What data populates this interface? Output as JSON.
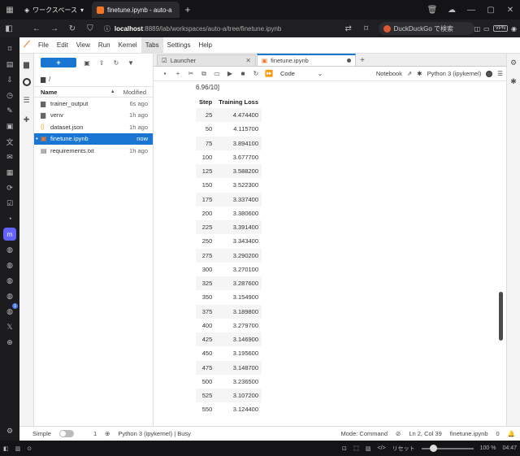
{
  "browser": {
    "workspace_label": "ワークスペース",
    "tab_title": "finetune.ipynb - auto-a",
    "url_host": "localhost",
    "url_rest": ":8889/lab/workspaces/auto-a/tree/finetune.ipynb",
    "search_placeholder": "DuckDuckGo で検索",
    "vpn_label": "VPN",
    "reset_label": "リセット",
    "zoom_level": "100 %",
    "clock": "04:47"
  },
  "menu": [
    "File",
    "Edit",
    "View",
    "Run",
    "Kernel",
    "Tabs",
    "Settings",
    "Help"
  ],
  "filebrowser": {
    "path": "/",
    "col_name": "Name",
    "col_modified": "Modified",
    "files": [
      {
        "name": "trainer_output",
        "modified": "6s ago",
        "type": "folder"
      },
      {
        "name": "venv",
        "modified": "1h ago",
        "type": "folder"
      },
      {
        "name": "dataset.json",
        "modified": "1h ago",
        "type": "json"
      },
      {
        "name": "finetune.ipynb",
        "modified": "now",
        "type": "notebook",
        "selected": true
      },
      {
        "name": "requirements.txt",
        "modified": "1h ago",
        "type": "file"
      }
    ]
  },
  "tabs": [
    {
      "label": "Launcher"
    },
    {
      "label": "finetune.ipynb"
    }
  ],
  "notebook": {
    "cell_type": "Code",
    "notebook_label": "Notebook",
    "kernel_name": "Python 3 (ipykernel)",
    "progress_text": "6.96/10]",
    "table": {
      "headers": [
        "Step",
        "Training Loss"
      ],
      "rows": [
        [
          "25",
          "4.474400"
        ],
        [
          "50",
          "4.115700"
        ],
        [
          "75",
          "3.894100"
        ],
        [
          "100",
          "3.677700"
        ],
        [
          "125",
          "3.588200"
        ],
        [
          "150",
          "3.522300"
        ],
        [
          "175",
          "3.337400"
        ],
        [
          "200",
          "3.380600"
        ],
        [
          "225",
          "3.391400"
        ],
        [
          "250",
          "3.343400"
        ],
        [
          "275",
          "3.290200"
        ],
        [
          "300",
          "3.270100"
        ],
        [
          "325",
          "3.287600"
        ],
        [
          "350",
          "3.154900"
        ],
        [
          "375",
          "3.189800"
        ],
        [
          "400",
          "3.279700"
        ],
        [
          "425",
          "3.146900"
        ],
        [
          "450",
          "3.195600"
        ],
        [
          "475",
          "3.148700"
        ],
        [
          "500",
          "3.236500"
        ],
        [
          "525",
          "3.107200"
        ],
        [
          "550",
          "3.124400"
        ]
      ]
    }
  },
  "status": {
    "simple_label": "Simple",
    "terminals_count": "1",
    "kernel_status": "Python 3 (ipykernel) | Busy",
    "mode": "Mode: Command",
    "cursor": "Ln 2, Col 39",
    "filename": "finetune.ipynb",
    "notifications": "0"
  }
}
